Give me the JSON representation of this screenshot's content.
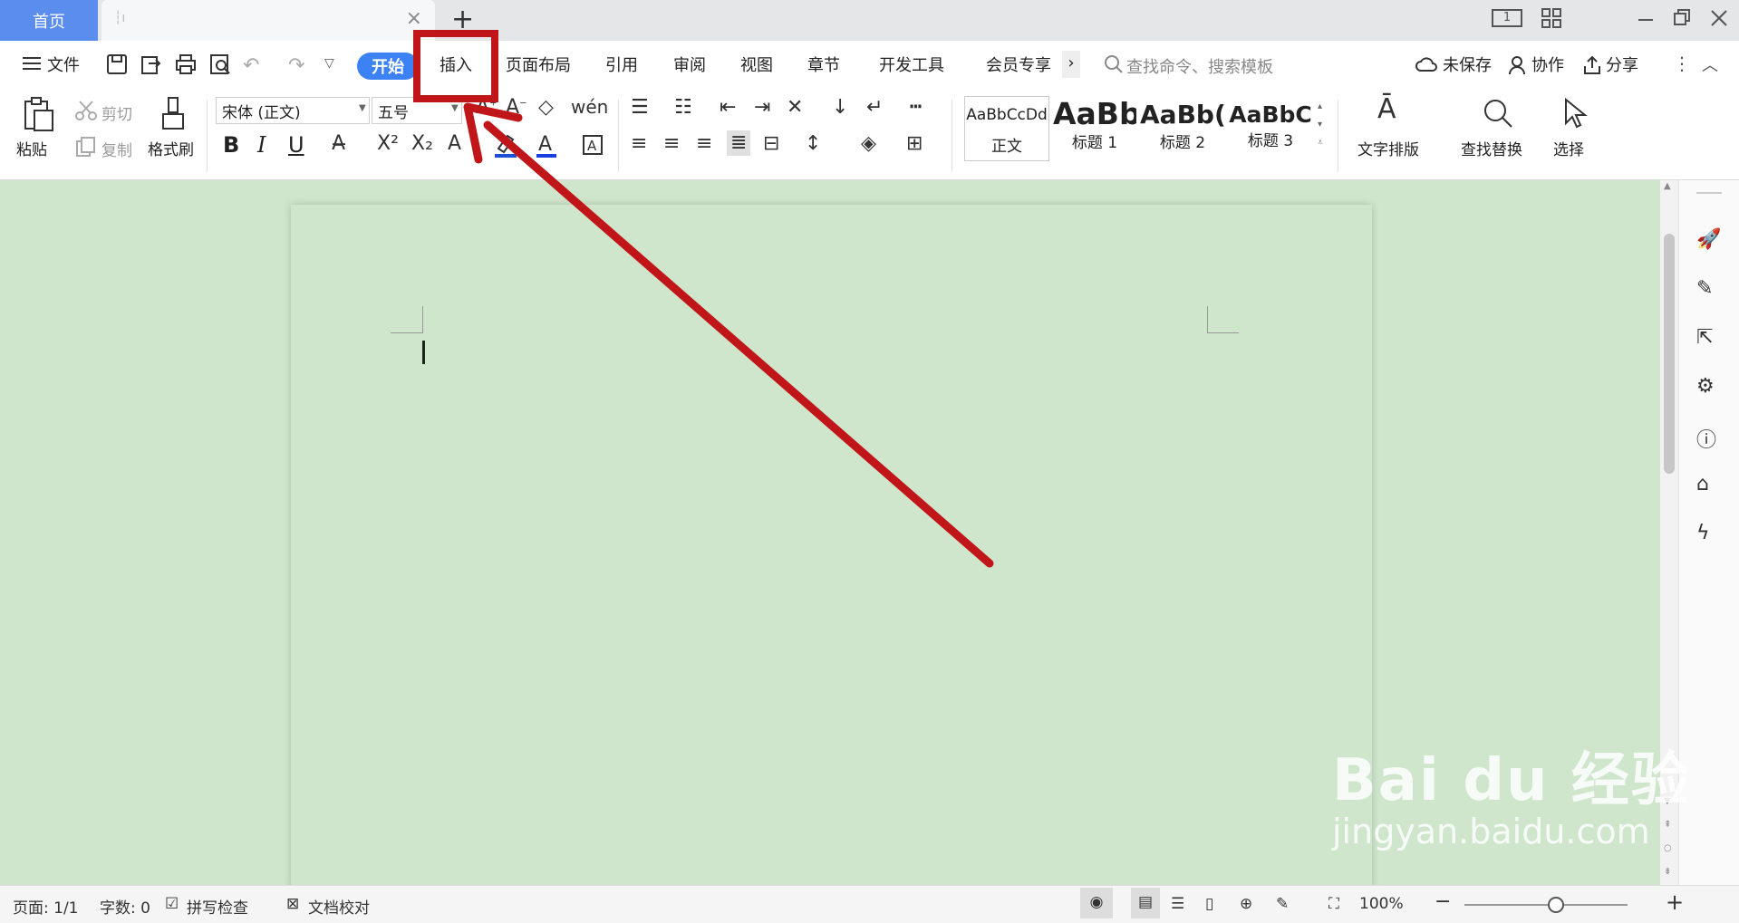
{
  "titlebar": {
    "home_tab": "首页",
    "new_tab_symbol": "+",
    "close_symbol": "×",
    "page_indicator": "1"
  },
  "menu": {
    "file": "文件",
    "start": "开始",
    "insert": "插入",
    "page_layout": "页面布局",
    "references": "引用",
    "review": "审阅",
    "view": "视图",
    "chapter": "章节",
    "dev_tools": "开发工具",
    "member": "会员专享",
    "more": "›",
    "search_placeholder": "查找命令、搜索模板",
    "unsaved": "未保存",
    "collaborate": "协作",
    "share": "分享"
  },
  "ribbon": {
    "paste": "粘贴",
    "cut": "剪切",
    "copy": "复制",
    "format_painter": "格式刷",
    "font_name": "宋体 (正文)",
    "font_size": "五号",
    "bold": "B",
    "italic": "I",
    "underline": "U",
    "styles": [
      {
        "sample": "AaBbCcDd",
        "label": "正文"
      },
      {
        "sample": "AaBb",
        "label": "标题 1"
      },
      {
        "sample": "AaBb(",
        "label": "标题 2"
      },
      {
        "sample": "AaBbC",
        "label": "标题 3"
      }
    ],
    "text_layout": "文字排版",
    "find_replace": "查找替换",
    "select": "选择"
  },
  "status": {
    "page": "页面: 1/1",
    "word_count": "字数: 0",
    "spell_check": "拼写检查",
    "doc_proof": "文档校对",
    "zoom": "100%",
    "zoom_minus": "−",
    "zoom_plus": "+"
  },
  "watermark": {
    "brand": "Bai du 经验",
    "url": "jingyan.baidu.com"
  },
  "colors": {
    "accent_blue": "#3c82f5",
    "home_tab": "#5b8def",
    "annotation_red": "#c0161a",
    "page_green": "#cfe6cc"
  },
  "annotation": {
    "target_tab": "insert"
  }
}
